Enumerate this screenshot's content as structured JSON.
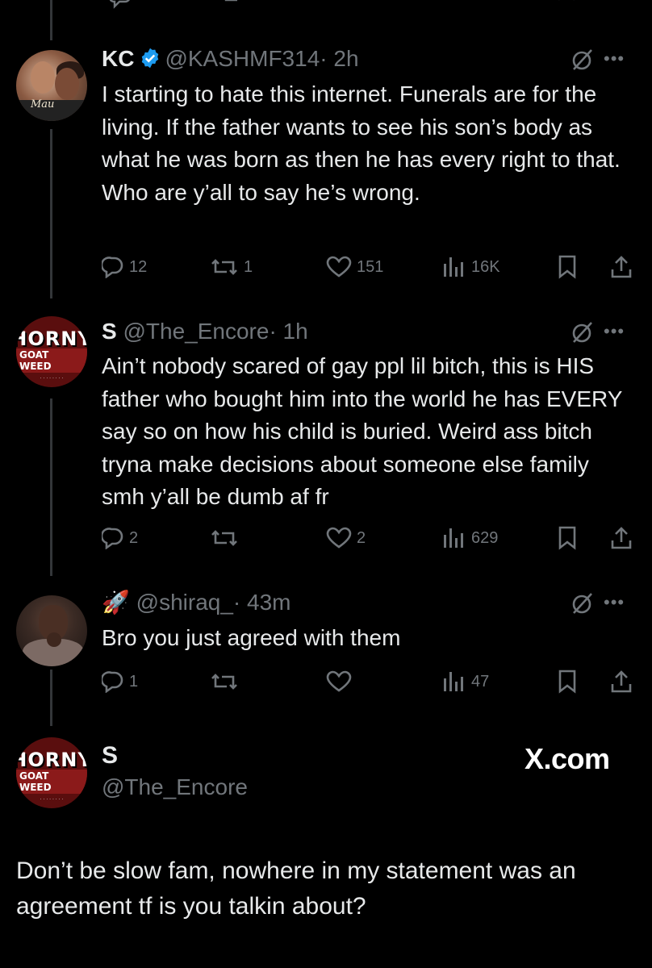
{
  "top_actions": {
    "replies": "",
    "reposts": "",
    "likes": "",
    "views": ""
  },
  "tweets": [
    {
      "name": "KC",
      "handle": "@KASHMF314",
      "time": "· 2h",
      "verified": true,
      "avatar_icon": "couple-avatar",
      "avatar_logo": "Mau",
      "text": "I starting to hate this internet. Funerals are for the living. If the father wants to see his son’s body as what he was born as then he has every right to that. Who are y’all to say he’s wrong.",
      "replies": "12",
      "reposts": "1",
      "likes": "151",
      "views": "16K"
    },
    {
      "name": "S",
      "handle": "@The_Encore",
      "time": "· 1h",
      "verified": false,
      "avatar_icon": "horny-goat-weed-avatar",
      "text": "Ain’t nobody scared of gay ppl lil bitch, this is HIS father who bought him into the world he has EVERY say so on how his child is buried. Weird ass bitch tryna make decisions about someone else family smh y’all be dumb af fr",
      "replies": "2",
      "reposts": "",
      "likes": "2",
      "views": "629"
    },
    {
      "name": "🚀",
      "handle": "@shiraq_",
      "time": "· 43m",
      "verified": false,
      "avatar_icon": "man-avatar",
      "text": "Bro you just agreed with them",
      "replies": "1",
      "reposts": "",
      "likes": "",
      "views": "47"
    }
  ],
  "avatar_brand": {
    "line1": "HORNY",
    "line2": "GOAT WEED"
  },
  "final_post": {
    "name": "S",
    "handle": "@The_Encore",
    "text": "Don’t be slow fam, nowhere in my statement was an agreement tf is you talkin about?"
  },
  "watermark": "X.com",
  "colors": {
    "background": "#000000",
    "text": "#e7e9ea",
    "muted": "#71767b",
    "verified": "#1d9bf0"
  }
}
